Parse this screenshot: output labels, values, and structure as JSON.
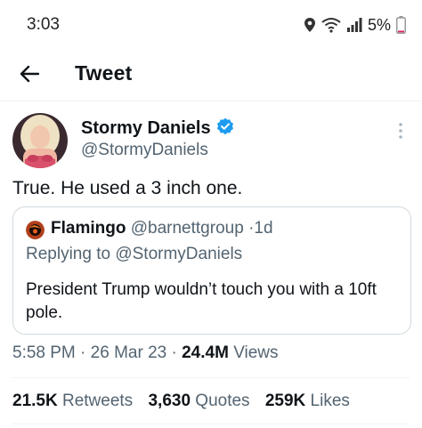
{
  "status_bar": {
    "time": "3:03",
    "battery_percent": "5%",
    "icons": [
      "location-icon",
      "wifi-icon",
      "signal-icon",
      "battery-icon"
    ]
  },
  "header": {
    "title": "Tweet",
    "back_icon": "arrow-left-icon"
  },
  "tweet": {
    "display_name": "Stormy Daniels",
    "verified": true,
    "handle": "@StormyDaniels",
    "text": "True. He used a 3 inch one.",
    "time": "5:58 PM",
    "date": "26 Mar 23",
    "views_count": "24.4M",
    "views_label": "Views",
    "separator": "·"
  },
  "quoted_tweet": {
    "display_name": "Flamingo",
    "handle": "@barnettgroup",
    "age": "1d",
    "separator": "·",
    "replying_to": "Replying to @StormyDaniels",
    "text": "President Trump wouldn’t touch you with a 10ft pole."
  },
  "stats": {
    "retweets_count": "21.5K",
    "retweets_label": "Retweets",
    "quotes_count": "3,630",
    "quotes_label": "Quotes",
    "likes_count": "259K",
    "likes_label": "Likes"
  },
  "colors": {
    "text_primary": "#0f1419",
    "text_secondary": "#536471",
    "verified_blue": "#1d9bf0",
    "border": "#cfd9de",
    "battery_low": "#e0245e"
  }
}
